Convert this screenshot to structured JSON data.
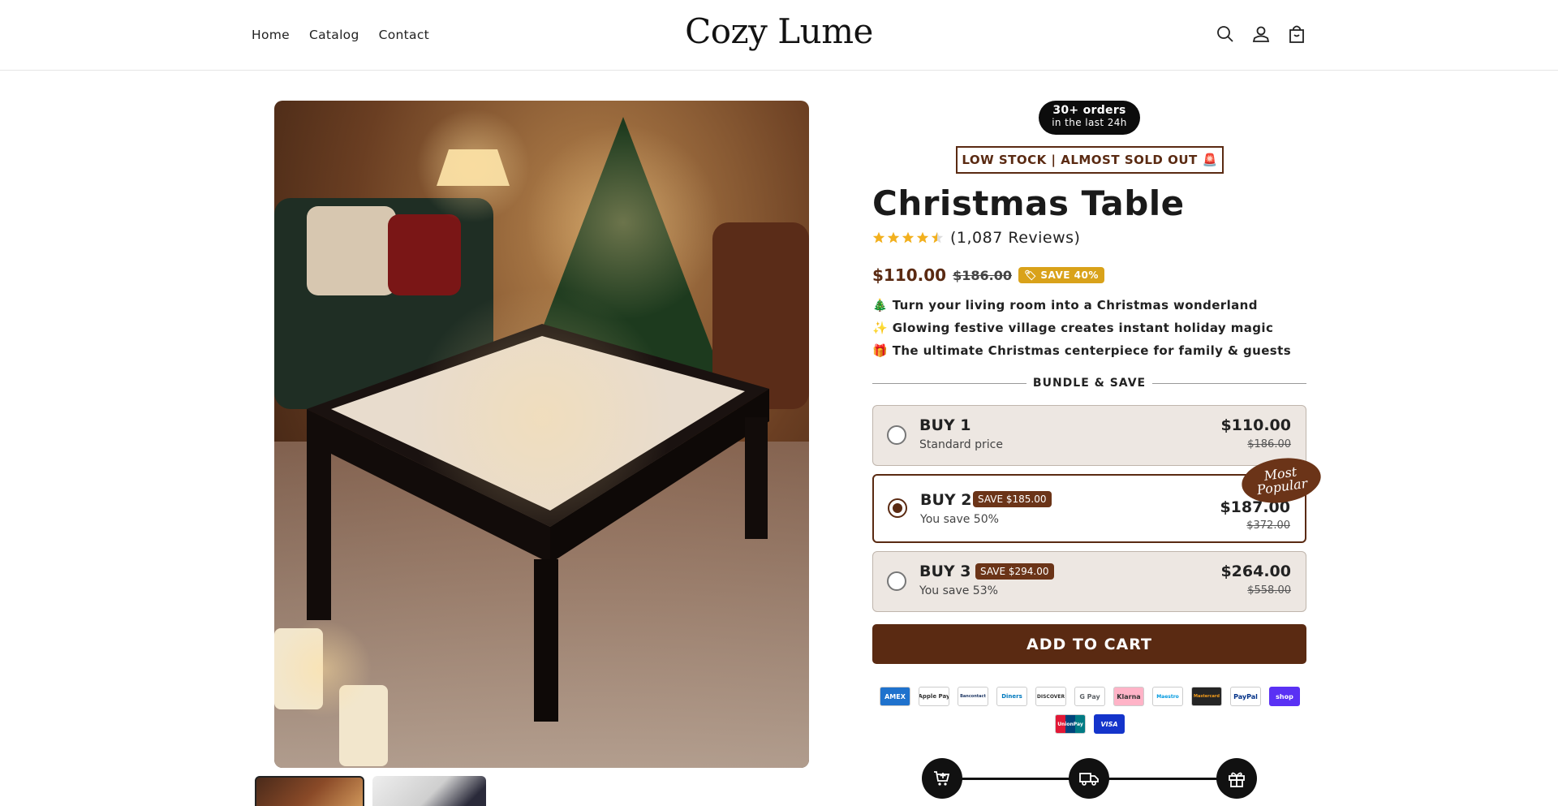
{
  "header": {
    "nav": [
      "Home",
      "Catalog",
      "Contact"
    ],
    "logo": "Cozy Lume",
    "icons": [
      "search-icon",
      "account-icon",
      "cart-icon"
    ]
  },
  "gallery": {
    "thumbnails": 2,
    "active_thumbnail": 0
  },
  "product": {
    "orders_badge": {
      "bold": "30+ orders",
      "small": "in the last 24h"
    },
    "stock_banner": "LOW STOCK | ALMOST SOLD OUT 🚨",
    "title": "Christmas Table",
    "rating": 4.5,
    "reviews": "(1,087 Reviews)",
    "price": "$110.00",
    "compare_price": "$186.00",
    "save_badge": "SAVE 40%",
    "bullets": [
      "🎄 Turn your living room into a Christmas wonderland",
      "✨ Glowing festive village creates instant holiday magic",
      "🎁 The ultimate Christmas centerpiece for family & guests"
    ]
  },
  "bundle": {
    "heading": "BUNDLE & SAVE",
    "popular_label_1": "Most",
    "popular_label_2": "Popular",
    "options": [
      {
        "name": "BUY 1",
        "tag": "",
        "sub": "Standard price",
        "price": "$110.00",
        "compare": "$186.00",
        "selected": false
      },
      {
        "name": "BUY 2",
        "tag": "SAVE $185.00",
        "sub": "You save 50%",
        "price": "$187.00",
        "compare": "$372.00",
        "selected": true
      },
      {
        "name": "BUY 3",
        "tag": "SAVE $294.00",
        "sub": "You save 53%",
        "price": "$264.00",
        "compare": "$558.00",
        "selected": false
      }
    ]
  },
  "add_to_cart": "ADD TO CART",
  "payments": {
    "row1": [
      "AMEX",
      "Apple Pay",
      "Bancontact",
      "Diners",
      "DISCOVER",
      "G Pay",
      "Klarna",
      "Maestro",
      "Mastercard",
      "PayPal",
      "shop"
    ],
    "row2": [
      "UnionPay",
      "VISA"
    ]
  },
  "steps": [
    "cart-plus-icon",
    "truck-icon",
    "gift-icon"
  ],
  "colors": {
    "brand": "#5a2a12",
    "badge_gold": "#d9a21a",
    "option_bg": "#ede7e2"
  }
}
